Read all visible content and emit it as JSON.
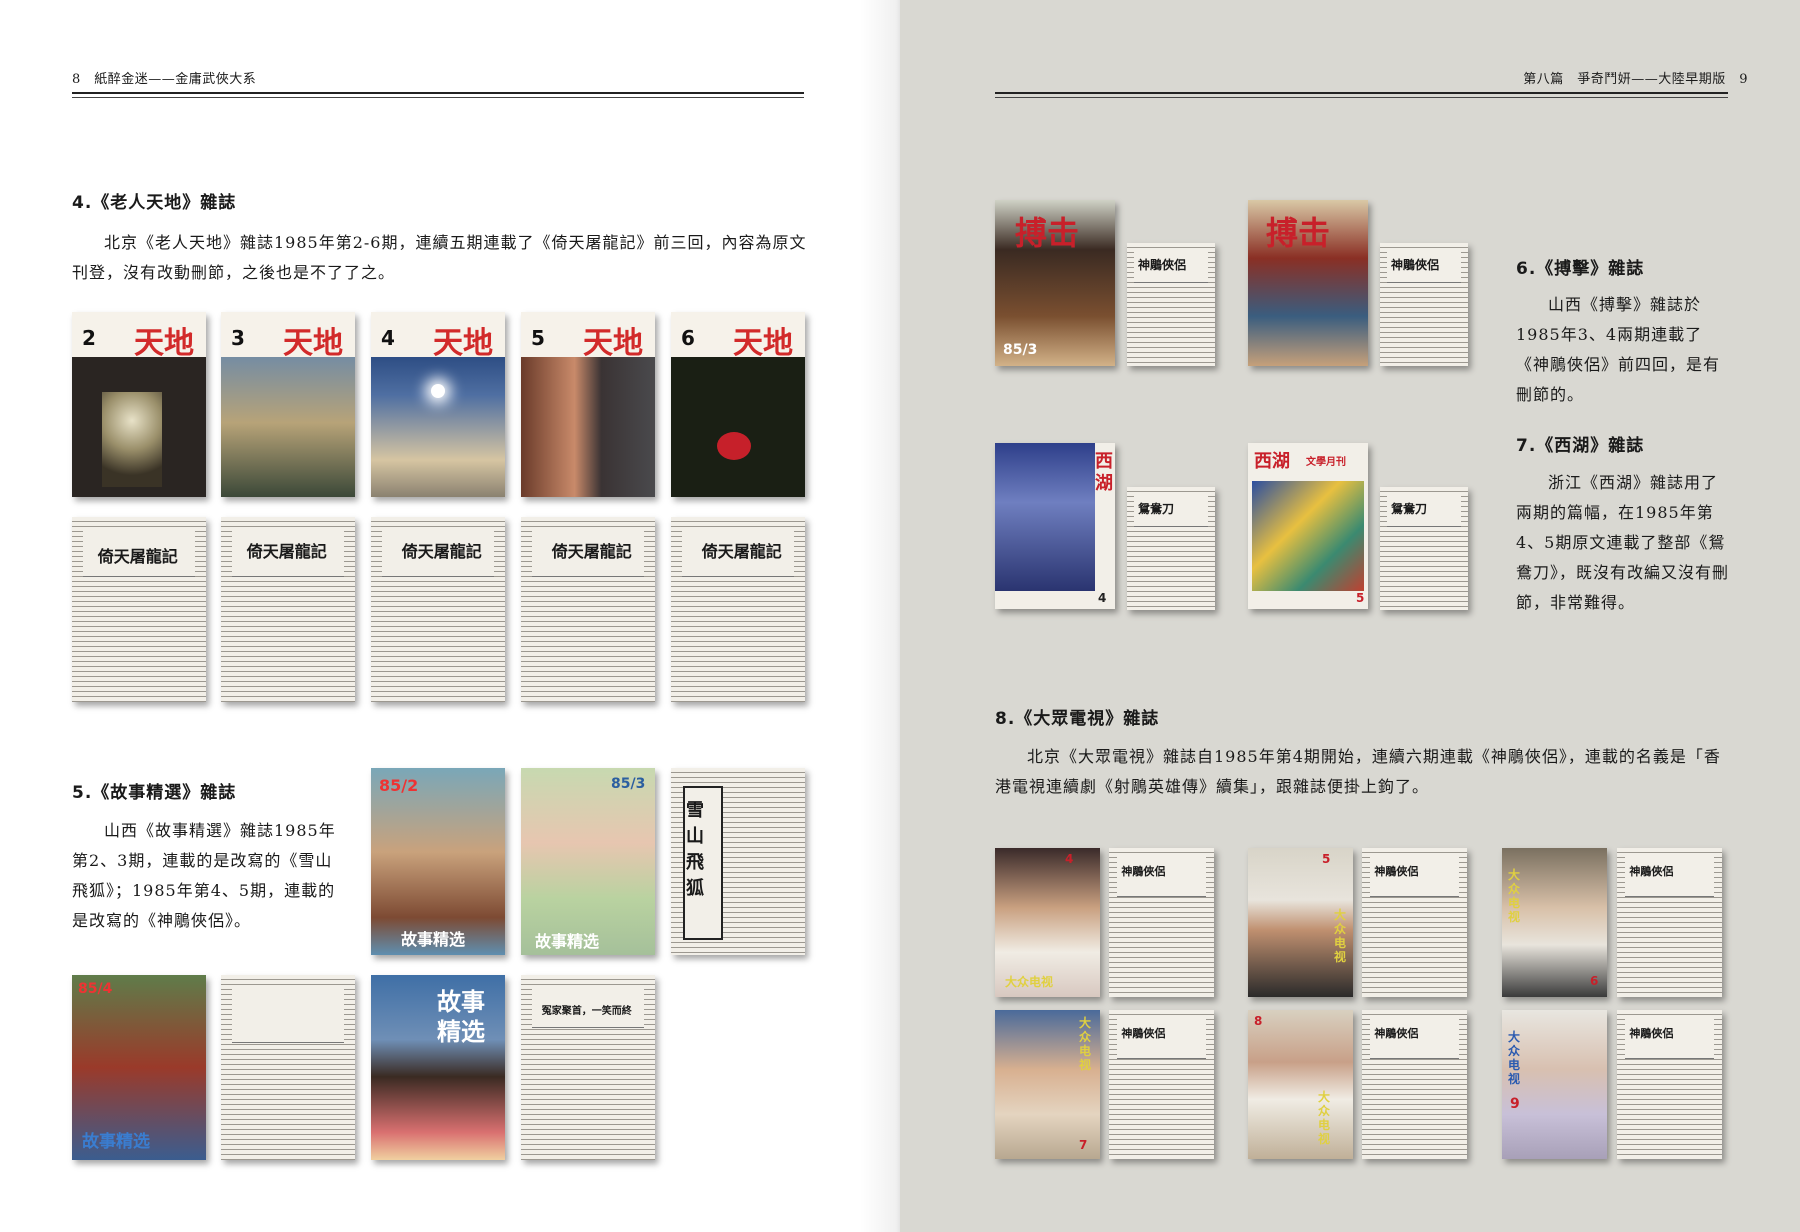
{
  "left_page": {
    "running_head": "8　紙醉金迷——金庸武俠大系",
    "section4": {
      "heading": "4.《老人天地》雜誌",
      "body": "北京《老人天地》雜誌1985年第2-6期，連續五期連載了《倚天屠龍記》前三回，內容為原文刊登，沒有改動刪節，之後也是不了了之。",
      "cover_issues": [
        "2",
        "3",
        "4",
        "5",
        "6"
      ],
      "cover_title": "天地",
      "page_title": "倚天屠龍記"
    },
    "section5": {
      "heading": "5.《故事精選》雜誌",
      "body": "山西《故事精選》雜誌1985年第2、3期，連載的是改寫的《雪山飛狐》；1985年第4、5期，連載的是改寫的《神鵰俠侶》。",
      "cover_labels": [
        "故事精选",
        "故事精选",
        "故事精选",
        "故事精选"
      ],
      "cover_issue_marks": [
        "85/2",
        "85/3",
        "85/4"
      ],
      "page_titles": [
        "雪山飛狐",
        "冤家聚首，一笑而終"
      ]
    }
  },
  "right_page": {
    "running_head": "第八篇　爭奇鬥妍——大陸早期版　9",
    "section6": {
      "heading": "6.《搏擊》雜誌",
      "body": "山西《搏擊》雜誌於1985年3、4兩期連載了《神鵰俠侶》前四回，是有刪節的。",
      "cover_title": "搏击",
      "cover_issue": "85/3",
      "page_title": "神鵰俠侶"
    },
    "section7": {
      "heading": "7.《西湖》雜誌",
      "body": "浙江《西湖》雜誌用了兩期的篇幅，在1985年第4、5期原文連載了整部《鴛鴦刀》，既沒有改編又沒有刪節，非常難得。",
      "cover_title": "西湖",
      "cover_subtitle": "文學月刊",
      "cover_issues": [
        "4",
        "5"
      ],
      "page_title": "鴛鴦刀"
    },
    "section8": {
      "heading": "8.《大眾電視》雜誌",
      "body": "北京《大眾電視》雜誌自1985年第4期開始，連續六期連載《神鵰俠侶》，連載的名義是「香港電視連續劇《射鵰英雄傳》續集」，跟雜誌便掛上鉤了。",
      "cover_title": "大众电视",
      "cover_issues": [
        "4",
        "5",
        "6",
        "7",
        "8",
        "9"
      ],
      "page_title": "神鵰俠侶"
    }
  },
  "colors": {
    "left_bg": "#ffffff",
    "right_bg": "#d9d8d2",
    "tiandi_red": "#d22a2a",
    "text": "#1a1a1a"
  }
}
